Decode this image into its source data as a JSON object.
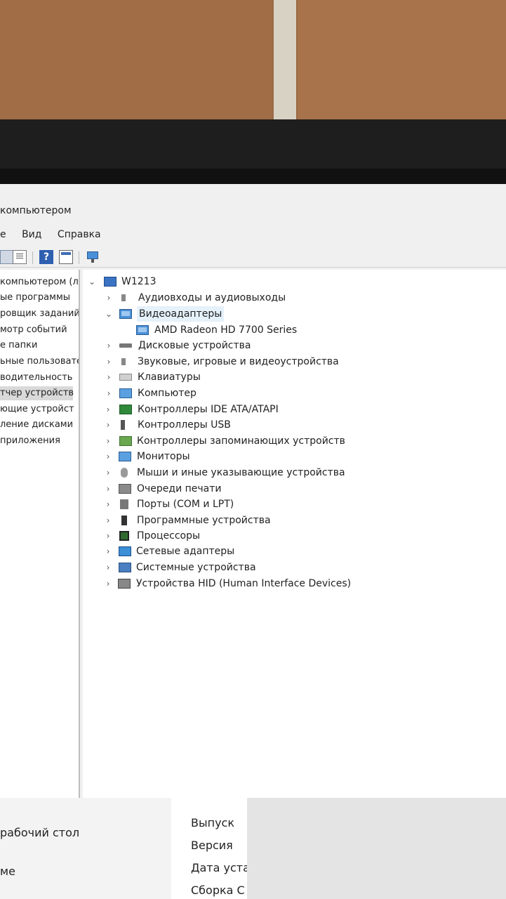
{
  "window": {
    "title": "компьютером",
    "menu": [
      "е",
      "Вид",
      "Справка"
    ]
  },
  "left_pane": {
    "items": [
      {
        "label": "компьютером (л"
      },
      {
        "label": "ые программы"
      },
      {
        "label": "ровщик заданий"
      },
      {
        "label": "мотр событий"
      },
      {
        "label": "е папки"
      },
      {
        "label": "ьные пользовате"
      },
      {
        "label": "водительность"
      },
      {
        "label": "тчер устройств",
        "selected": true
      },
      {
        "label": "ющие устройст"
      },
      {
        "label": "ление дисками"
      },
      {
        "label": "приложения"
      }
    ]
  },
  "tree": {
    "root": {
      "label": "W1213",
      "icon": "computer-icon"
    },
    "nodes": [
      {
        "label": "Аудиовходы и аудиовыходы",
        "icon": "speaker-icon",
        "expander": "›"
      },
      {
        "label": "Видеоадаптеры",
        "icon": "display-adapter-icon",
        "expander": "⌄"
      },
      {
        "label": "AMD Radeon HD 7700 Series",
        "icon": "display-adapter-icon",
        "child": true
      },
      {
        "label": "Дисковые устройства",
        "icon": "disk-icon",
        "expander": "›"
      },
      {
        "label": "Звуковые, игровые и видеоустройства",
        "icon": "speaker-icon",
        "expander": "›"
      },
      {
        "label": "Клавиатуры",
        "icon": "keyboard-icon",
        "expander": "›"
      },
      {
        "label": "Компьютер",
        "icon": "monitor-icon",
        "expander": "›"
      },
      {
        "label": "Контроллеры IDE ATA/ATAPI",
        "icon": "chip-icon",
        "expander": "›"
      },
      {
        "label": "Контроллеры USB",
        "icon": "usb-icon",
        "expander": "›"
      },
      {
        "label": "Контроллеры запоминающих устройств",
        "icon": "storage-controller-icon",
        "expander": "›"
      },
      {
        "label": "Мониторы",
        "icon": "monitor-icon",
        "expander": "›"
      },
      {
        "label": "Мыши и иные указывающие устройства",
        "icon": "mouse-icon",
        "expander": "›"
      },
      {
        "label": "Очереди печати",
        "icon": "printer-icon",
        "expander": "›"
      },
      {
        "label": "Порты (COM и LPT)",
        "icon": "port-icon",
        "expander": "›"
      },
      {
        "label": "Программные устройства",
        "icon": "software-device-icon",
        "expander": "›"
      },
      {
        "label": "Процессоры",
        "icon": "cpu-icon",
        "expander": "›"
      },
      {
        "label": "Сетевые адаптеры",
        "icon": "network-adapter-icon",
        "expander": "›"
      },
      {
        "label": "Системные устройства",
        "icon": "system-device-icon",
        "expander": "›"
      },
      {
        "label": "Устройства HID (Human Interface Devices)",
        "icon": "hid-icon",
        "expander": "›"
      }
    ]
  },
  "lower": {
    "left": [
      "рабочий стол",
      "ме"
    ],
    "mid": [
      "Выпуск",
      "Версия",
      "Дата уста",
      "Сборка С"
    ]
  },
  "toolbar": {
    "help_glyph": "?"
  },
  "scroll": {
    "arrow": "›"
  }
}
